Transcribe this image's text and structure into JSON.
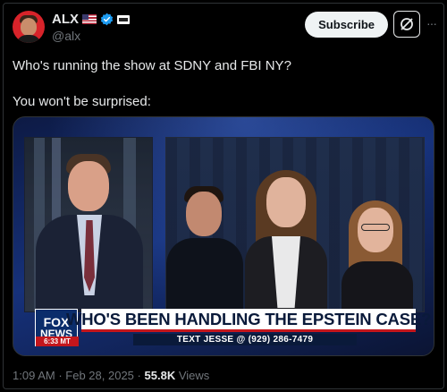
{
  "author": {
    "display_name": "ALX",
    "handle": "@alx",
    "badges": [
      "us-flag-icon",
      "verified-icon",
      "affiliate-badge-icon"
    ]
  },
  "actions": {
    "subscribe_label": "Subscribe",
    "grok_icon": "grok-icon",
    "more_icon": "more-icon"
  },
  "tweet": {
    "lines": [
      "Who's running the show at SDNY and FBI NY?",
      "You won't be surprised:"
    ]
  },
  "media": {
    "logo_line1": "FOX",
    "logo_line2": "NEWS",
    "logo_time": "6:33 MT",
    "headline": "WHO'S BEEN HANDLING THE EPSTEIN CASE?",
    "subline": "TEXT JESSE @ (929) 286-7479"
  },
  "meta": {
    "time": "1:09 AM",
    "separator": "·",
    "date": "Feb 28, 2025",
    "views_count": "55.8K",
    "views_label": "Views"
  },
  "colors": {
    "background": "#000000",
    "text": "#e7e9ea",
    "muted": "#71767b",
    "verified": "#1d9bf0",
    "subscribe_bg": "#eff3f4",
    "fox_red": "#c4161c",
    "fox_navy": "#0a1a3a"
  }
}
